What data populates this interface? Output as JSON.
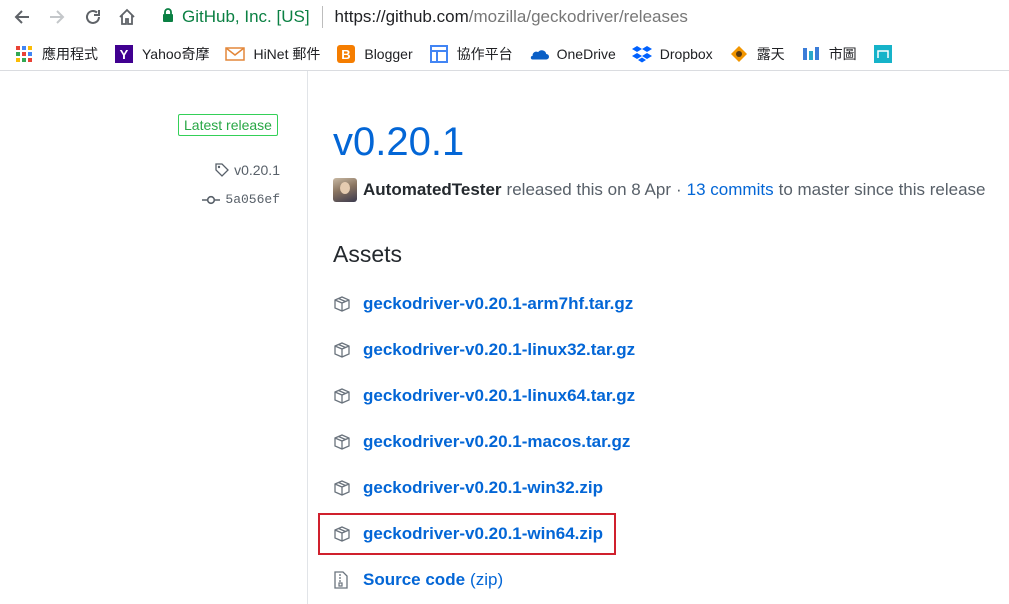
{
  "browser": {
    "nav": {
      "back": "back-icon",
      "forward": "forward-icon",
      "reload": "reload-icon",
      "home": "home-icon"
    },
    "omnibox": {
      "org": "GitHub, Inc. [US]",
      "url_host": "https://github.com",
      "url_path": "/mozilla/geckodriver/releases"
    },
    "bookmarks": [
      {
        "label": "應用程式",
        "icon": "apps-grid-icon"
      },
      {
        "label": "Yahoo奇摩",
        "icon": "yahoo-icon"
      },
      {
        "label": "HiNet 郵件",
        "icon": "mail-icon"
      },
      {
        "label": "Blogger",
        "icon": "blogger-icon"
      },
      {
        "label": "協作平台",
        "icon": "sites-icon"
      },
      {
        "label": "OneDrive",
        "icon": "onedrive-icon"
      },
      {
        "label": "Dropbox",
        "icon": "dropbox-icon"
      },
      {
        "label": "露天",
        "icon": "ruten-icon"
      },
      {
        "label": "市圖",
        "icon": "library-icon"
      },
      {
        "label": "",
        "icon": "extra-bookmark-icon"
      }
    ]
  },
  "release": {
    "badge": "Latest release",
    "tag": "v0.20.1",
    "commit": "5a056ef",
    "title": "v0.20.1",
    "author": "AutomatedTester",
    "released_text": "released this on 8 Apr",
    "separator": "·",
    "commits_link": "13 commits",
    "commits_suffix": "to master since this release"
  },
  "assets": {
    "heading": "Assets",
    "items": [
      {
        "name": "geckodriver-v0.20.1-arm7hf.tar.gz",
        "suffix": ""
      },
      {
        "name": "geckodriver-v0.20.1-linux32.tar.gz",
        "suffix": ""
      },
      {
        "name": "geckodriver-v0.20.1-linux64.tar.gz",
        "suffix": ""
      },
      {
        "name": "geckodriver-v0.20.1-macos.tar.gz",
        "suffix": ""
      },
      {
        "name": "geckodriver-v0.20.1-win32.zip",
        "suffix": ""
      },
      {
        "name": "geckodriver-v0.20.1-win64.zip",
        "suffix": ""
      },
      {
        "name": "Source code",
        "suffix": "(zip)"
      }
    ],
    "highlighted": "geckodriver-v0.20.1-win64.zip"
  },
  "colors": {
    "link": "#0366d6",
    "badge_green": "#28a745",
    "highlight_red": "#d0202d",
    "secure_green": "#0b8043"
  }
}
